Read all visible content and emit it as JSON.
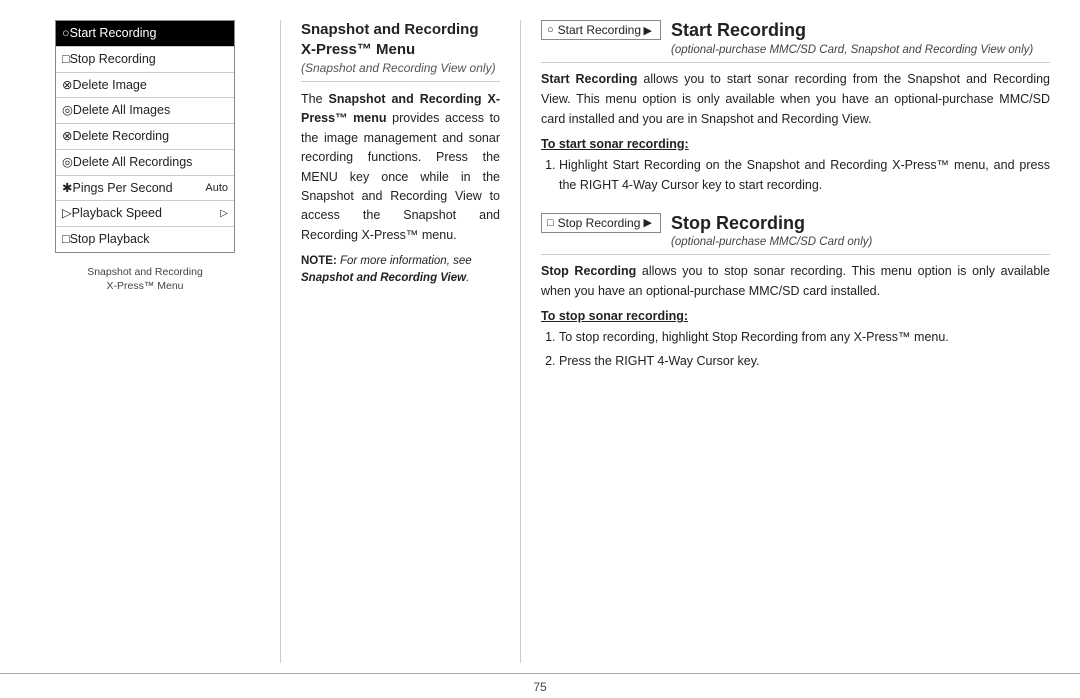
{
  "page": {
    "number": "75"
  },
  "left_column": {
    "menu_items": [
      {
        "icon": "○",
        "label": "Start Recording",
        "highlight": true,
        "extra": ""
      },
      {
        "icon": "□",
        "label": "Stop Recording",
        "highlight": false,
        "extra": ""
      },
      {
        "icon": "⊗",
        "label": "Delete Image",
        "highlight": false,
        "extra": ""
      },
      {
        "icon": "◎",
        "label": "Delete All Images",
        "highlight": false,
        "extra": ""
      },
      {
        "icon": "⊗",
        "label": "Delete Recording",
        "highlight": false,
        "extra": ""
      },
      {
        "icon": "◎",
        "label": "Delete All Recordings",
        "highlight": false,
        "extra": ""
      },
      {
        "icon": "✱",
        "label": "Pings Per Second",
        "highlight": false,
        "extra": "Auto"
      },
      {
        "icon": "▷",
        "label": "Playback Speed",
        "highlight": false,
        "extra": "▷"
      },
      {
        "icon": "□",
        "label": "Stop Playback",
        "highlight": false,
        "extra": ""
      }
    ],
    "caption_line1": "Snapshot and Recording",
    "caption_line2": "X-Press™ Menu"
  },
  "middle_column": {
    "title_line1": "Snapshot and Recording",
    "title_line2": "X-Press™ Menu",
    "subtitle": "(Snapshot and Recording View only)",
    "body": "The Snapshot and Recording X-Press™ menu provides access to the image management and sonar recording functions. Press the MENU key once while in the Snapshot and Recording View to access the Snapshot and Recording X-Press™ menu.",
    "note_prefix": "NOTE:",
    "note_text": " For more information, see ",
    "note_bold": "Snapshot and Recording View",
    "note_end": "."
  },
  "right_column": {
    "section1": {
      "indicator_icon": "○",
      "indicator_label": "Start Recording",
      "indicator_arrow": "▶",
      "title": "Start Recording",
      "note": "(optional-purchase MMC/SD Card, Snapshot and Recording View only)",
      "body_bold": "Start Recording",
      "body": " allows you to start sonar recording from the Snapshot and Recording View. This menu option is only available when you have an optional-purchase MMC/SD card installed and you are in Snapshot and Recording View.",
      "sub_title": "To start sonar recording:",
      "steps": [
        "Highlight Start Recording on the Snapshot and Recording X-Press™ menu, and press the RIGHT 4-Way Cursor key to start recording."
      ]
    },
    "section2": {
      "indicator_icon": "□",
      "indicator_label": "Stop Recording",
      "indicator_arrow": "▶",
      "title": "Stop Recording",
      "note": "(optional-purchase MMC/SD Card only)",
      "body_bold": "Stop Recording",
      "body": " allows you to stop sonar recording. This menu option is only available when you have an optional-purchase MMC/SD card installed.",
      "sub_title": "To stop sonar recording:",
      "steps": [
        "To stop recording, highlight Stop Recording from any X-Press™ menu.",
        "Press the RIGHT 4-Way Cursor key."
      ]
    }
  }
}
